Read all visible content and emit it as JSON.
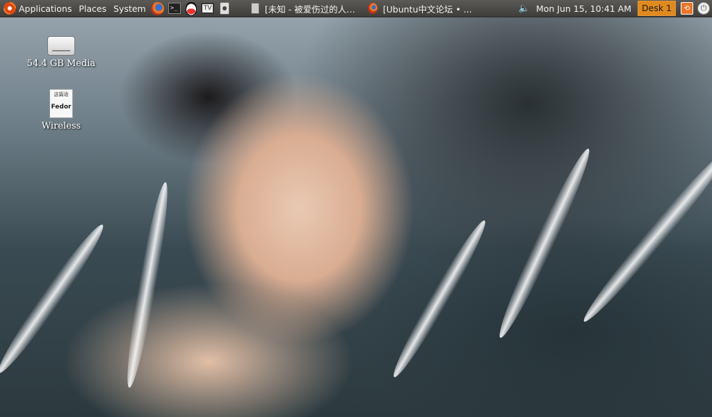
{
  "panel": {
    "menus": [
      "Applications",
      "Places",
      "System"
    ],
    "launchers": [
      {
        "icon": "firefox-icon"
      },
      {
        "icon": "terminal-icon",
        "glyph": ">_"
      },
      {
        "icon": "qq-icon"
      },
      {
        "icon": "tv-icon",
        "glyph": "TV"
      },
      {
        "icon": "webcam-icon"
      }
    ],
    "tasks": [
      {
        "title": "[未知 - 被爱伤过的人…",
        "icon": "media-player-icon"
      },
      {
        "title": "[Ubuntu中文论坛 • ...",
        "icon": "firefox-icon"
      }
    ],
    "clock": "Mon Jun 15, 10:41 AM",
    "workspace": "Desk 1",
    "volume_glyph": "🔈",
    "box_glyph": "⟲",
    "power_glyph": "⏻"
  },
  "desktop": {
    "icons": [
      {
        "label": "54.4 GB Media",
        "icon": "drive-icon"
      },
      {
        "label": "Wireless",
        "icon": "document-icon",
        "doc_header": "这篇适",
        "doc_text": "Fedor"
      }
    ]
  }
}
